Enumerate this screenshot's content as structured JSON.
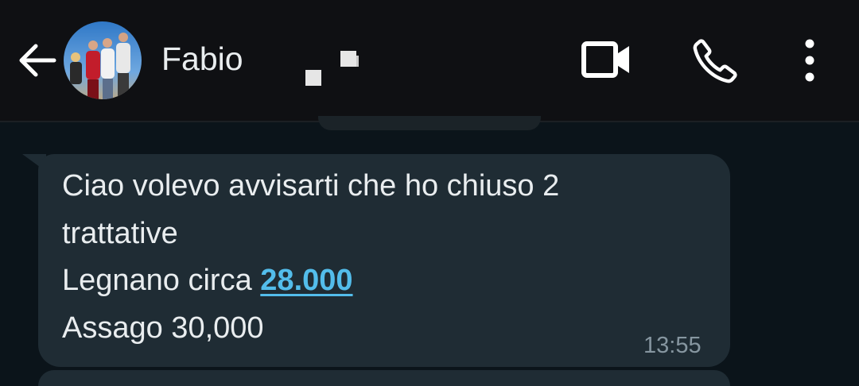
{
  "header": {
    "back_icon": "arrow-left-icon",
    "avatar_description": "group-photo-avatar",
    "contact_name": "Fabio",
    "status_text": "",
    "actions": {
      "video_icon": "video-camera-icon",
      "call_icon": "phone-icon",
      "menu_icon": "more-vertical-icon"
    }
  },
  "colors": {
    "background": "#0b141a",
    "header": "#0f1013",
    "bubble_incoming": "#1f2c34",
    "link": "#53bdeb",
    "text": "#e9edef",
    "meta": "#8696a0"
  },
  "message": {
    "lines": [
      "Ciao volevo avvisarti che ho chiuso 2",
      "trattative"
    ],
    "line3_prefix": "Legnano circa ",
    "line3_link": "28.000",
    "line4": "Assago 30,000",
    "time": "13:55"
  }
}
